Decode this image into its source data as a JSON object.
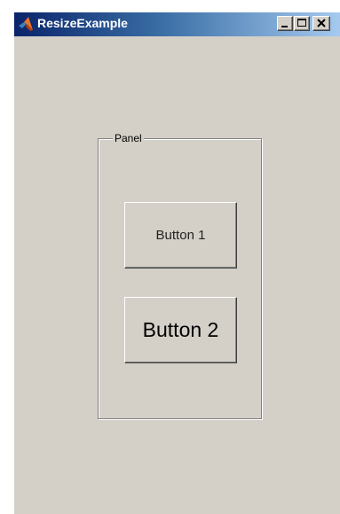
{
  "window": {
    "title": "ResizeExample",
    "icon": "matlab-logo-icon",
    "caption_buttons": [
      "minimize-icon",
      "maximize-icon",
      "close-icon"
    ]
  },
  "panel": {
    "title": "Panel",
    "buttons": [
      {
        "label": "Button 1"
      },
      {
        "label": "Button 2"
      }
    ]
  },
  "colors": {
    "window_background": "#d4d0c8",
    "titlebar_start": "#0a246a",
    "titlebar_end": "#a6caf0",
    "title_text": "#ffffff"
  }
}
